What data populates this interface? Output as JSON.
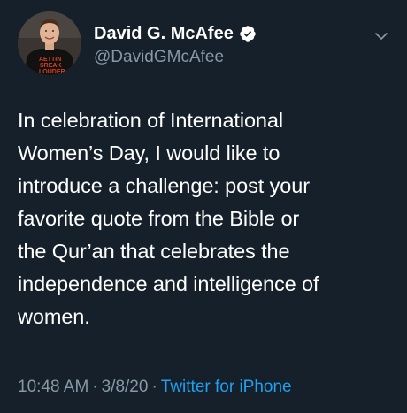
{
  "author": {
    "display_name": "David G. McAfee",
    "handle": "@DavidGMcAfee",
    "verified": true
  },
  "icons": {
    "verified": "verified-badge-icon",
    "caret": "chevron-down-icon"
  },
  "tweet": {
    "text": "In celebration of International\nWomen’s Day, I would like to\nintroduce a challenge: post your\nfavorite quote from the Bible or\nthe Qur’an that celebrates the\nindependence and intelligence of\nwomen."
  },
  "meta": {
    "time": "10:48 AM",
    "separator1": "·",
    "date": "3/8/20",
    "separator2": "·",
    "source": "Twitter for iPhone"
  },
  "colors": {
    "background": "#15202b",
    "secondary_text": "#8899a6",
    "link": "#1da1f2"
  }
}
